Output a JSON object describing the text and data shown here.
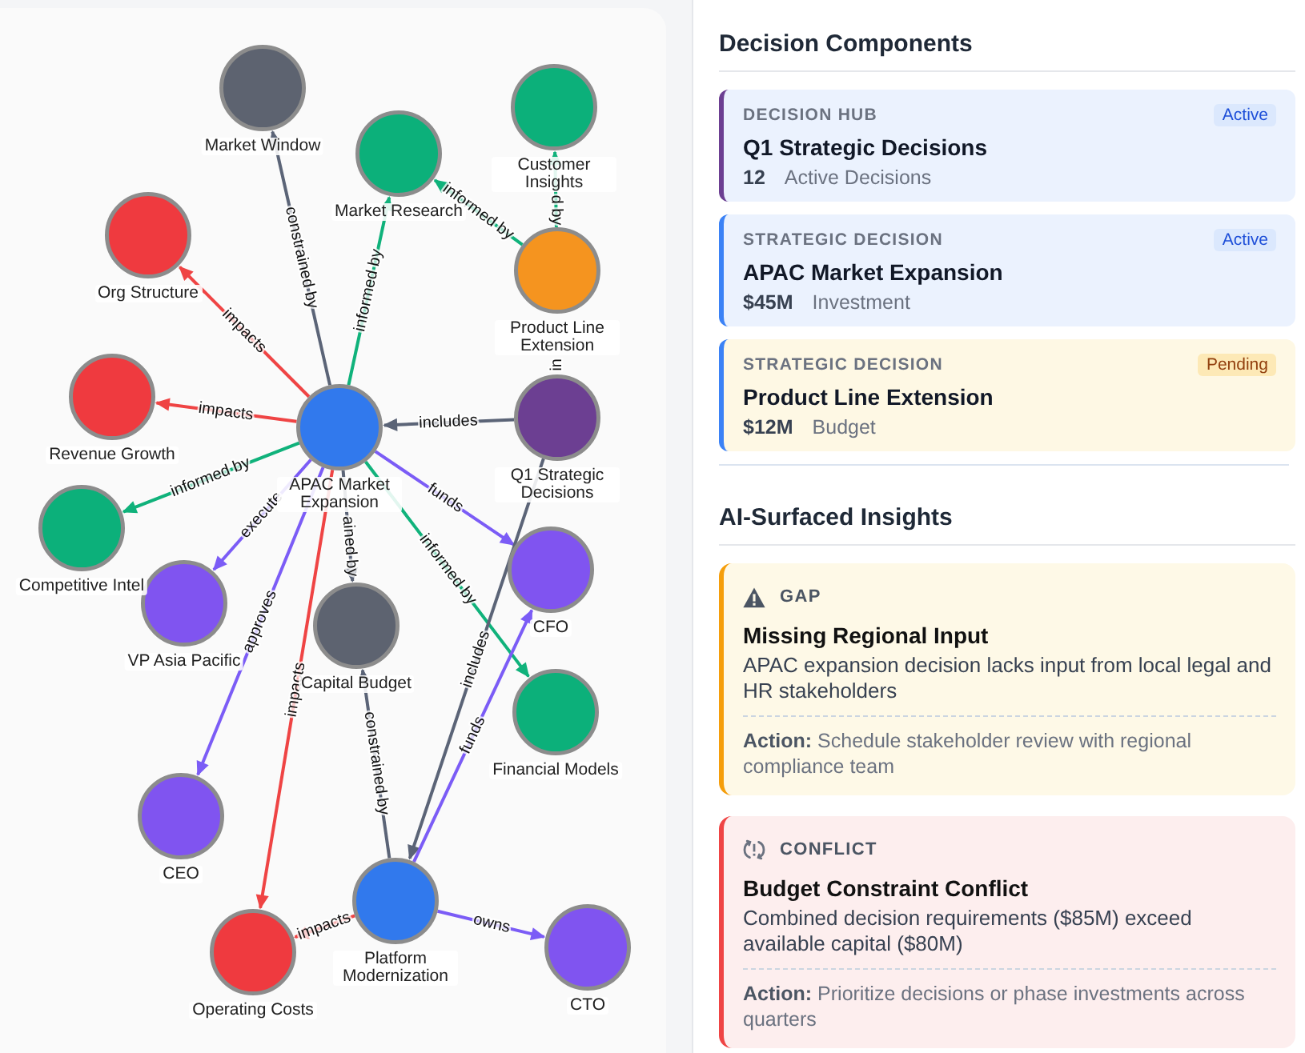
{
  "graph": {
    "nodes": [
      {
        "label": "Market Window",
        "color": "#5d6370"
      },
      {
        "label": "Customer Insights",
        "color": "#0cb07a"
      },
      {
        "label": "Market Research",
        "color": "#0cb07a"
      },
      {
        "label": "Org Structure",
        "color": "#ef3a3f"
      },
      {
        "label": "Product Line Extension",
        "color": "#f5941f"
      },
      {
        "label": "Revenue Growth",
        "color": "#ef3a3f"
      },
      {
        "label": "Q1 Strategic Decisions",
        "color": "#6c3f92"
      },
      {
        "label": "APAC Market Expansion",
        "color": "#3179ed"
      },
      {
        "label": "Competitive Intel",
        "color": "#0cb07a"
      },
      {
        "label": "CFO",
        "color": "#8054f0"
      },
      {
        "label": "VP Asia Pacific",
        "color": "#8054f0"
      },
      {
        "label": "Capital Budget",
        "color": "#5d6370"
      },
      {
        "label": "Financial Models",
        "color": "#0cb07a"
      },
      {
        "label": "CEO",
        "color": "#8054f0"
      },
      {
        "label": "Platform Modernization",
        "color": "#3179ed"
      },
      {
        "label": "CTO",
        "color": "#8054f0"
      },
      {
        "label": "Operating Costs",
        "color": "#ef3a3f"
      }
    ],
    "edges": [
      {
        "label": "constrained by",
        "color": "#5b6477"
      },
      {
        "label": "informed by",
        "color": "#10b27b"
      },
      {
        "label": "informed by",
        "color": "#10b27b"
      },
      {
        "label": "d by",
        "color": "#10b27b"
      },
      {
        "label": "impacts",
        "color": "#ef4444"
      },
      {
        "label": "in"
      },
      {
        "label": "impacts",
        "color": "#ef4444"
      },
      {
        "label": "includes",
        "color": "#5b6477"
      },
      {
        "label": "informed by",
        "color": "#10b27b"
      },
      {
        "label": "funds",
        "color": "#7b5cf6"
      },
      {
        "label": "execute",
        "color": "#7b5cf6"
      },
      {
        "label": "ained by",
        "color": "#5b6477"
      },
      {
        "label": "informed by",
        "color": "#10b27b"
      },
      {
        "label": "includes",
        "color": "#5b6477"
      },
      {
        "label": "approves",
        "color": "#7b5cf6"
      },
      {
        "label": "impacts",
        "color": "#ef4444"
      },
      {
        "label": "constrained by",
        "color": "#5b6477"
      },
      {
        "label": "funds",
        "color": "#7b5cf6"
      },
      {
        "label": "impacts",
        "color": "#ef4444"
      },
      {
        "label": "owns",
        "color": "#7b5cf6"
      }
    ]
  },
  "decision_components": {
    "heading": "Decision Components",
    "items": [
      {
        "kind": "hub",
        "type": "DECISION HUB",
        "badge": {
          "kind": "active",
          "label": "Active"
        },
        "title": "Q1 Strategic Decisions",
        "value": "12",
        "unit": "Active Decisions"
      },
      {
        "kind": "decision",
        "type": "STRATEGIC DECISION",
        "badge": {
          "kind": "active",
          "label": "Active"
        },
        "title": "APAC Market Expansion",
        "value": "$45M",
        "unit": "Investment"
      },
      {
        "kind": "decision",
        "type": "STRATEGIC DECISION",
        "badge": {
          "kind": "pending",
          "label": "Pending"
        },
        "title": "Product Line Extension",
        "value": "$12M",
        "unit": "Budget"
      }
    ]
  },
  "insights": {
    "heading": "AI-Surfaced Insights",
    "items": [
      {
        "kind": "gap",
        "tag": "GAP",
        "title": "Missing Regional Input",
        "description": "APAC expansion decision lacks input from local legal and HR stakeholders",
        "action": "**Action:** Schedule stakeholder review with regional compliance team"
      },
      {
        "kind": "conflict",
        "tag": "CONFLICT",
        "title": "Budget Constraint Conflict",
        "description": "Combined decision requirements ($85M) exceed available capital ($80M)",
        "action": "**Action:** Prioritize decisions or phase investments across quarters"
      }
    ]
  }
}
